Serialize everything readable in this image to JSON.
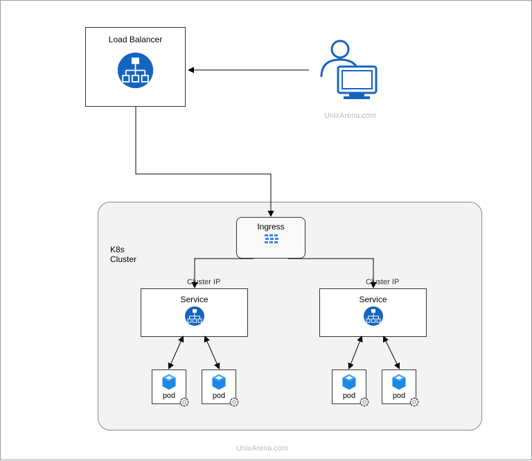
{
  "load_balancer": {
    "label": "Load Balancer"
  },
  "ingress": {
    "label": "Ingress"
  },
  "cluster": {
    "label": "K8s\nCluster"
  },
  "service1": {
    "label": "Service",
    "cluster_ip_label": "Cluster IP"
  },
  "service2": {
    "label": "Service",
    "cluster_ip_label": "Cluster IP"
  },
  "pods": {
    "pod1": "pod",
    "pod2": "pod",
    "pod3": "pod",
    "pod4": "pod"
  },
  "watermark": "UnixArena.com",
  "colors": {
    "primary_blue": "#1565c0",
    "light_blue": "#3b82f6"
  }
}
